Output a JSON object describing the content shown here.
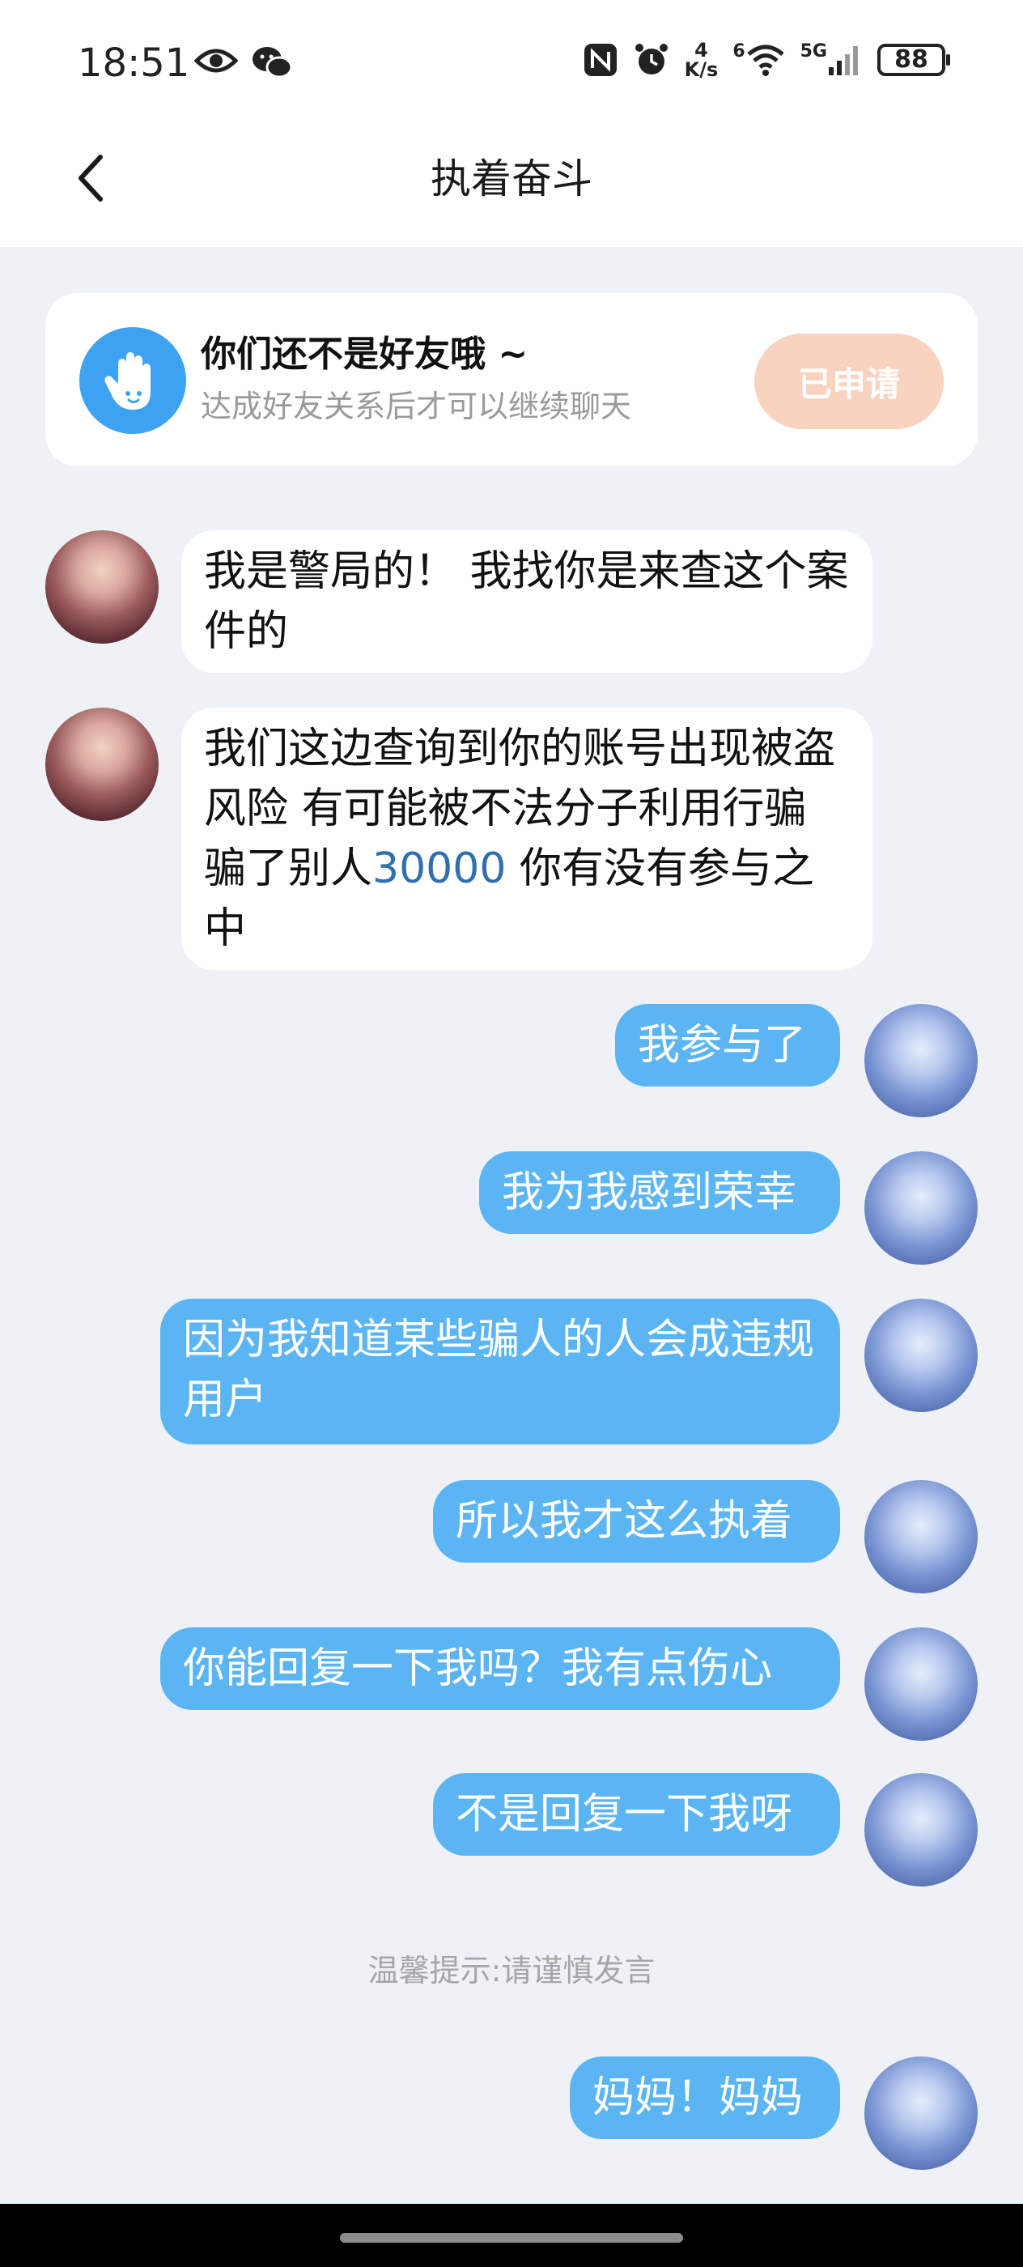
{
  "status_bar": {
    "time": "18:51",
    "net_speed_value": "4",
    "net_speed_unit": "K/s",
    "wifi_label": "6",
    "cell_label": "5G",
    "battery": "88"
  },
  "header": {
    "title": "执着奋斗"
  },
  "friend_notice": {
    "title": "你们还不是好友哦 ~",
    "subtitle": "达成好友关系后才可以继续聊天",
    "button_label": "已申请"
  },
  "messages": [
    {
      "side": "left",
      "text": "我是警局的！ 我找你是来查这个案件的"
    },
    {
      "side": "left",
      "parts": [
        "我们这边查询到你的账号出现被盗风险 有可能被不法分子利用行骗 骗了别人",
        "30000",
        " 你有没有参与之中"
      ]
    },
    {
      "side": "right",
      "text": "我参与了"
    },
    {
      "side": "right",
      "text": "我为我感到荣幸"
    },
    {
      "side": "right",
      "text": "因为我知道某些骗人的人会成违规用户"
    },
    {
      "side": "right",
      "text": "所以我才这么执着"
    },
    {
      "side": "right",
      "text": "你能回复一下我吗？我有点伤心"
    },
    {
      "side": "right",
      "text": "不是回复一下我呀"
    },
    {
      "side": "right",
      "text": "妈妈！妈妈"
    }
  ],
  "tip": "温馨提示:请谨慎发言",
  "colors": {
    "accent_blue": "#5cb5f3",
    "applied_button": "#f8d3c0",
    "page_background": "#eef1f6",
    "link_number": "#2f6fad"
  }
}
